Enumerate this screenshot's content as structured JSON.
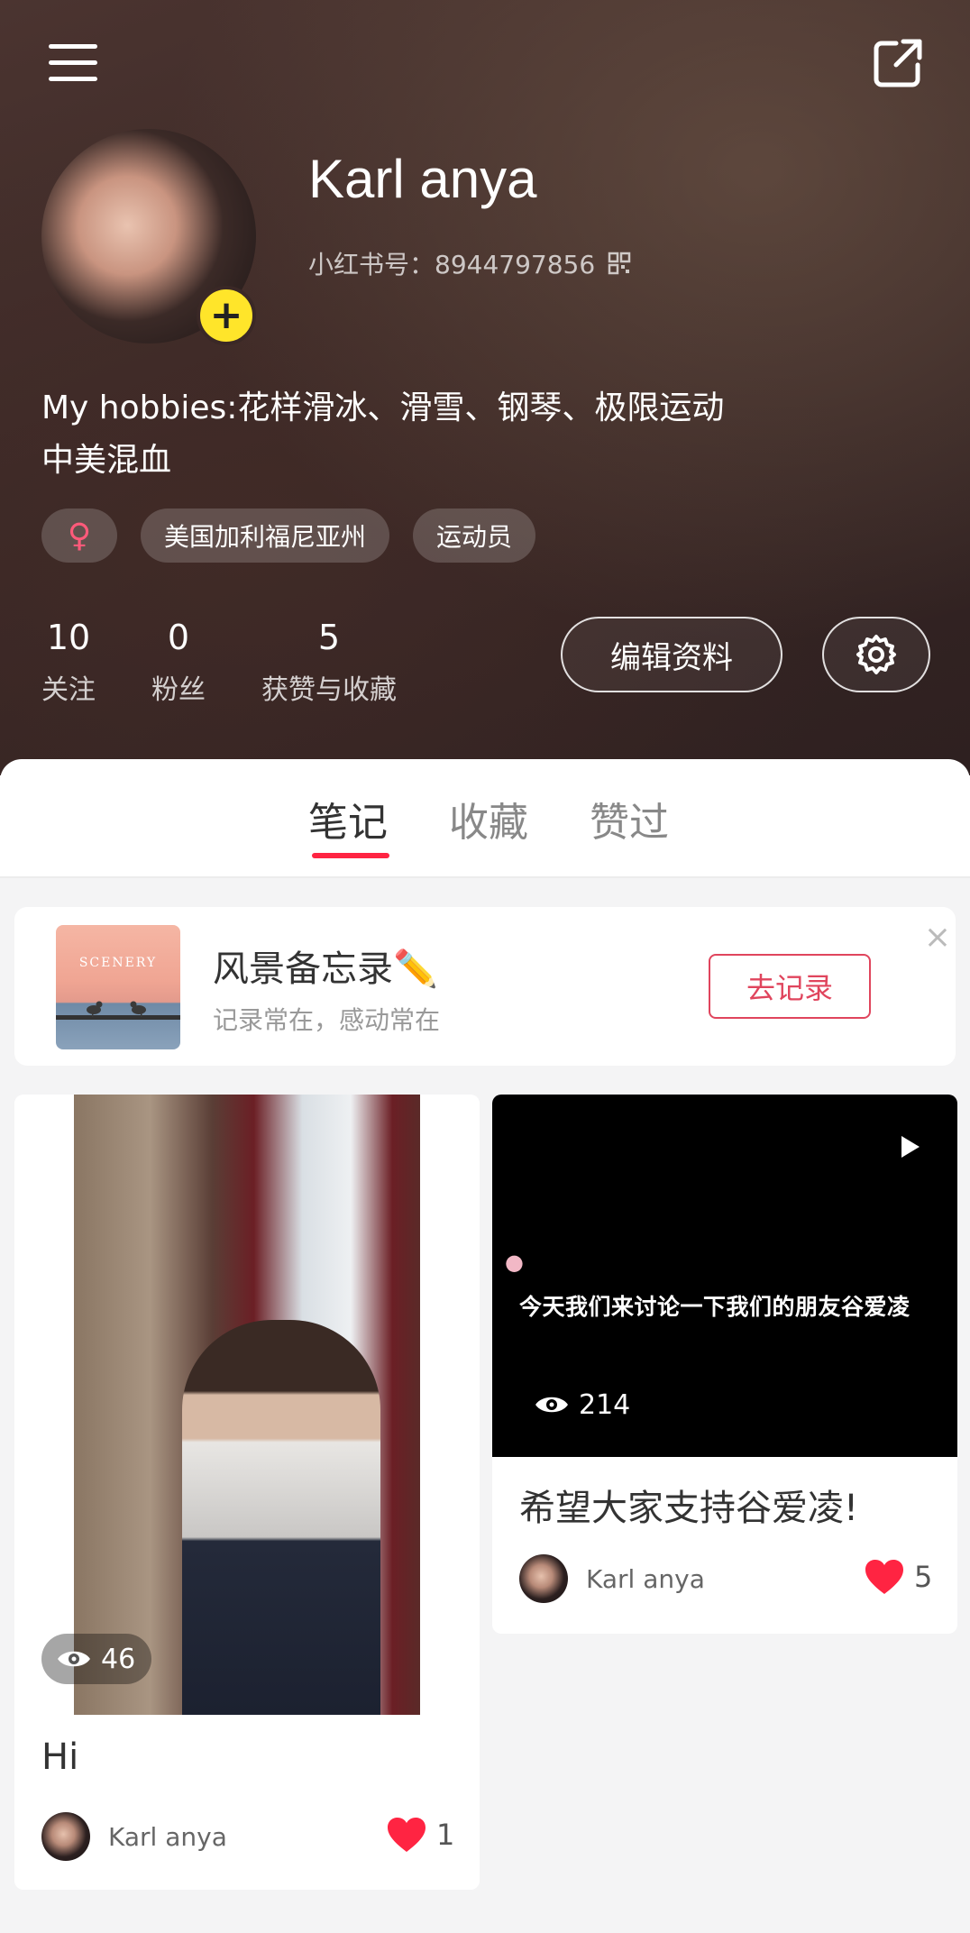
{
  "header": {
    "username": "Karl anya",
    "rednote_id": "小红书号：8944797856",
    "bio_line1": "My hobbies:花样滑冰、滑雪、钢琴、极限运动",
    "bio_line2": "中美混血",
    "tags": {
      "gender": "♀",
      "location": "美国加利福尼亚州",
      "occupation": "运动员"
    },
    "stats": {
      "following_count": "10",
      "following_label": "关注",
      "followers_count": "0",
      "followers_label": "粉丝",
      "likes_count": "5",
      "likes_label": "获赞与收藏"
    },
    "edit_label": "编辑资料",
    "add_badge": "+"
  },
  "tabs": {
    "notes": "笔记",
    "collections": "收藏",
    "liked": "赞过"
  },
  "banner": {
    "thumb_text": "SCENERY",
    "title": "风景备忘录✏️",
    "subtitle": "记录常在，感动常在",
    "cta": "去记录",
    "close": "×"
  },
  "posts": [
    {
      "title": "Hi",
      "views": "46",
      "author": "Karl anya",
      "likes": "1"
    },
    {
      "title": "希望大家支持谷爱凌!",
      "video_caption": "今天我们来讨论一下我们的朋友谷爱凌",
      "views": "214",
      "author": "Karl anya",
      "likes": "5"
    }
  ],
  "colors": {
    "accent": "#ff2442",
    "badge_yellow": "#ffe52a",
    "cta_red": "#e0455d"
  }
}
